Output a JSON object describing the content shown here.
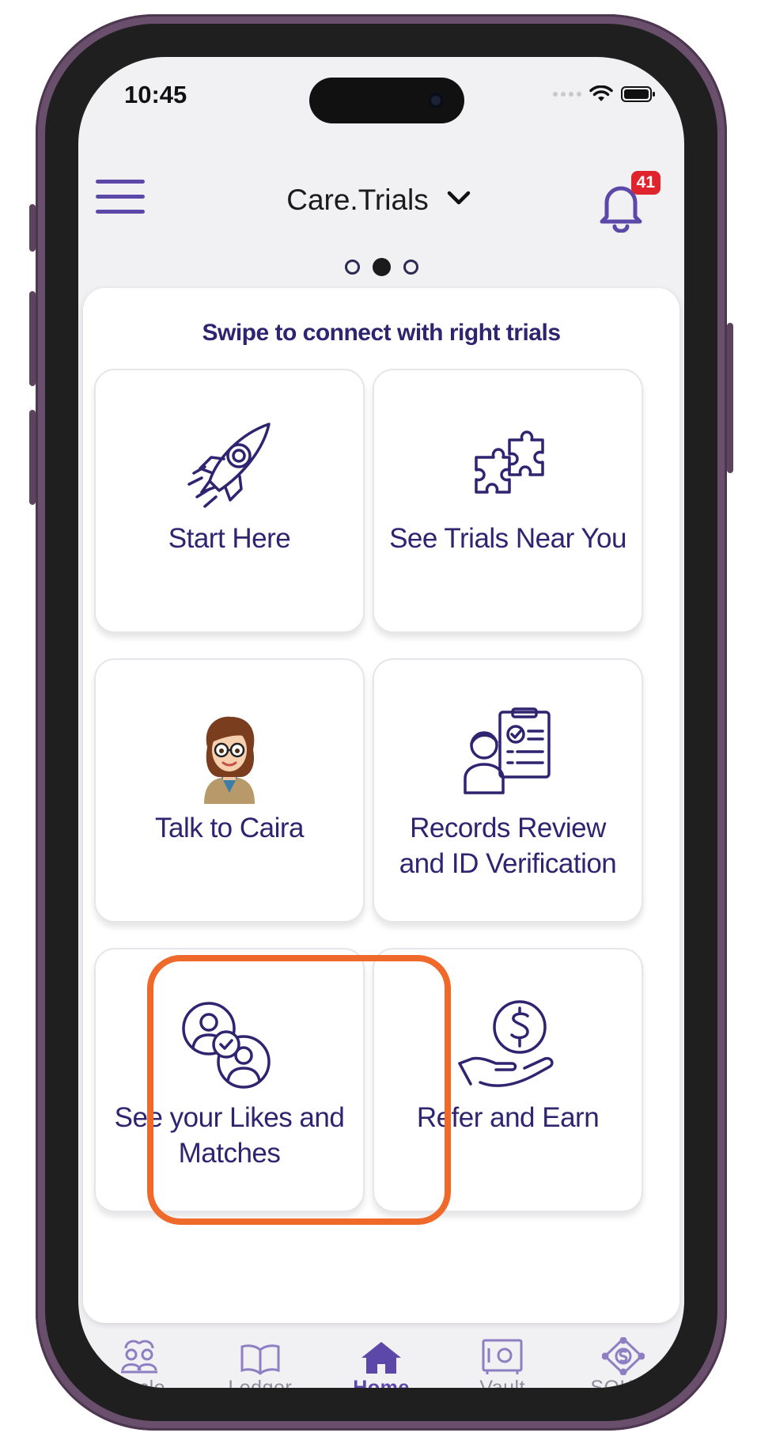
{
  "status_bar": {
    "time": "10:45"
  },
  "header": {
    "title": "Care.Trials",
    "notification_count": "41"
  },
  "pager": {
    "total": 3,
    "active_index": 1
  },
  "panel": {
    "heading": "Swipe to connect with right trials",
    "tiles": [
      {
        "label": "Start Here",
        "icon": "rocket-icon"
      },
      {
        "label": "See Trials Near You",
        "icon": "puzzle-icon"
      },
      {
        "label": "Talk to Caira",
        "icon": "caira-avatar"
      },
      {
        "label_line1": "Records Review",
        "label_line2": "and ID Verification",
        "icon": "records-review-icon"
      },
      {
        "label_line1": "See your Likes and",
        "label_line2": "Matches",
        "icon": "likes-matches-icon",
        "highlighted": true
      },
      {
        "label": "Refer and Earn",
        "icon": "refer-earn-icon"
      }
    ]
  },
  "tab_bar": {
    "active": "Home",
    "items": [
      {
        "label": "Circle",
        "icon": "circle-people-icon"
      },
      {
        "label": "Ledger",
        "icon": "book-icon"
      },
      {
        "label": "Home",
        "icon": "home-icon"
      },
      {
        "label": "Vault",
        "icon": "vault-icon"
      },
      {
        "label": "SOLVE",
        "icon": "solve-icon"
      }
    ]
  },
  "colors": {
    "brand": "#5b48a8",
    "text_dark_navy": "#2e2470",
    "badge_red": "#e0242e",
    "highlight_orange": "#ef6a2a",
    "tab_inactive": "#8d8d9c"
  }
}
